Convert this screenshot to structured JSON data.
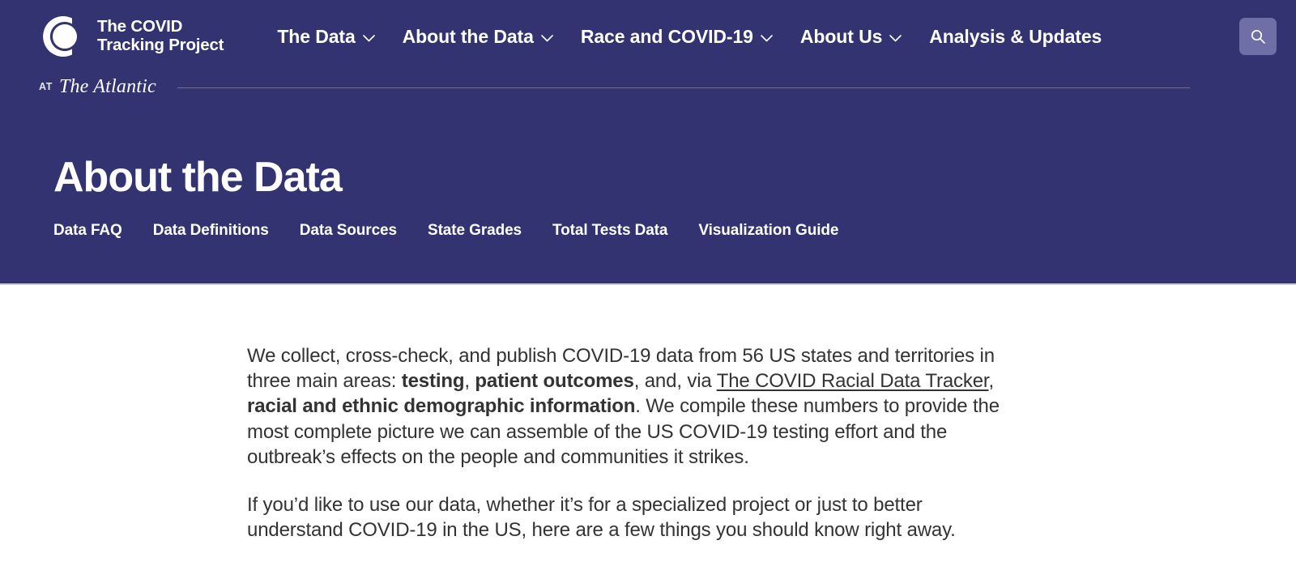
{
  "header": {
    "background_color": "#343372",
    "brand": {
      "logo_icon": "covid-tracking-project-ring-logo",
      "line1": "The COVID",
      "line2": "Tracking Project"
    },
    "nav": [
      {
        "label": "The Data",
        "has_dropdown": true,
        "chevron_icon": "chevron-down-icon"
      },
      {
        "label": "About the Data",
        "has_dropdown": true,
        "chevron_icon": "chevron-down-icon"
      },
      {
        "label": "Race and COVID-19",
        "has_dropdown": true,
        "chevron_icon": "chevron-down-icon"
      },
      {
        "label": "About Us",
        "has_dropdown": true,
        "chevron_icon": "chevron-down-icon"
      },
      {
        "label": "Analysis & Updates",
        "has_dropdown": false,
        "chevron_icon": ""
      }
    ],
    "search": {
      "icon": "search-icon",
      "button_color": "#6d6fa6",
      "aria_label": "Search"
    },
    "affiliation": {
      "prefix": "AT",
      "publication": "The Atlantic"
    }
  },
  "page": {
    "title": "About the Data",
    "sub_nav": [
      {
        "label": "Data FAQ"
      },
      {
        "label": "Data Definitions"
      },
      {
        "label": "Data Sources"
      },
      {
        "label": "State Grades"
      },
      {
        "label": "Total Tests Data"
      },
      {
        "label": "Visualization Guide"
      }
    ]
  },
  "body": {
    "paragraph1": {
      "part1": "We collect, cross-check, and publish COVID-19 data from 56 US states and territories in three main areas: ",
      "bold1": "testing",
      "part2": ", ",
      "bold2": "patient outcomes",
      "part3": ", and, via ",
      "link_text": "The COVID Racial Data Tracker",
      "part4": ", ",
      "bold3": "racial and ethnic demographic information",
      "part5": ". We compile these numbers to provide the most complete picture we can assemble of the US COVID-19 testing effort and the outbreak’s effects on the people and communities it strikes."
    },
    "paragraph2": "If you’d like to use our data, whether it’s for a specialized project or just to better understand COVID-19 in the US, here are a few things you should know right away."
  }
}
